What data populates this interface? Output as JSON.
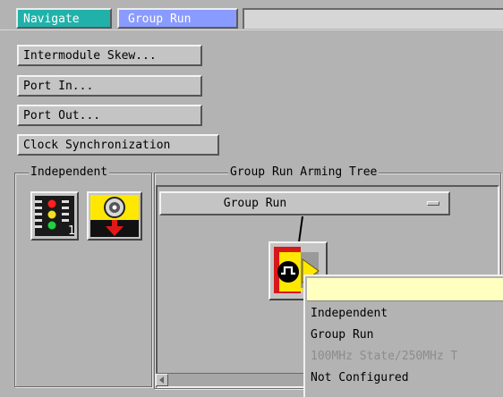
{
  "tabs": [
    {
      "label": "Navigate",
      "color": "#20b2aa"
    },
    {
      "label": "Group Run",
      "color": "#8a9bff"
    }
  ],
  "buttons": {
    "skew": "Intermodule Skew...",
    "port_in": "Port In...",
    "port_out": "Port Out...",
    "clock_sync": "Clock Synchronization"
  },
  "independent": {
    "title": "Independent",
    "module_badge": "1"
  },
  "tree": {
    "title": "Group Run Arming Tree",
    "dropdown_value": "Group Run"
  },
  "menu": {
    "items": [
      {
        "label": "Independent",
        "enabled": true
      },
      {
        "label": "Group Run",
        "enabled": true
      },
      {
        "label": "100MHz State/250MHz T",
        "enabled": false
      },
      {
        "label": "Not Configured",
        "enabled": true
      }
    ],
    "header_color": "#ffffc0"
  }
}
